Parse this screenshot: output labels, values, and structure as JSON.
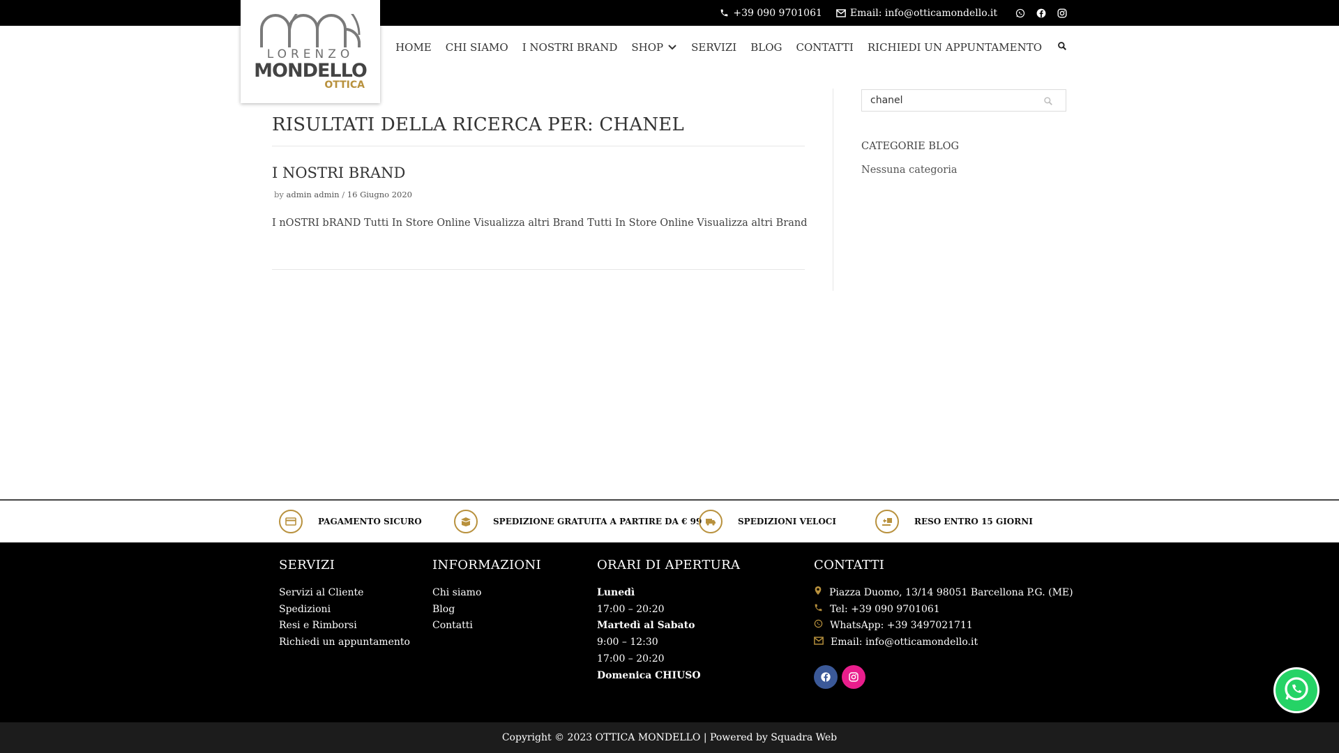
{
  "topbar": {
    "phone": "+39 090 9701061",
    "email": "Email: info@otticamondello.it",
    "socials": [
      "whatsapp-icon",
      "facebook-icon",
      "instagram-icon"
    ]
  },
  "logo": {
    "line1": "LORENZO",
    "line2": "MONDELLO",
    "line3": "OTTICA"
  },
  "nav": {
    "items": [
      "HOME",
      "CHI SIAMO",
      "I NOSTRI BRAND",
      "SHOP",
      "SERVIZI",
      "BLOG",
      "CONTATTI",
      "RICHIEDI UN APPUNTAMENTO"
    ]
  },
  "main": {
    "results_title": "RISULTATI DELLA RICERCA PER: CHANEL",
    "post": {
      "title": "I NOSTRI BRAND",
      "by": "by",
      "author": "admin admin",
      "sep": "/",
      "date": "16 Giugno 2020",
      "excerpt": "I nOSTRI bRAND Tutti In Store Online Visualizza altri Brand Tutti In Store Online Visualizza altri Brand"
    }
  },
  "sidebar": {
    "search_value": "chanel",
    "categories_title": "CATEGORIE BLOG",
    "categories_empty": "Nessuna categoria"
  },
  "features": [
    "PAGAMENTO SICURO",
    "SPEDIZIONE GRATUITA A PARTIRE DA € 99",
    "SPEDIZIONI VELOCI",
    "RESO ENTRO 15 GIORNI"
  ],
  "footer": {
    "servizi": {
      "title": "SERVIZI",
      "items": [
        "Servizi al Cliente",
        "Spedizioni",
        "Resi e Rimborsi",
        "Richiedi un appuntamento"
      ]
    },
    "info": {
      "title": "INFORMAZIONI",
      "items": [
        "Chi siamo",
        "Blog",
        "Contatti"
      ]
    },
    "orari": {
      "title": "ORARI DI APERTURA",
      "lines": [
        {
          "text": "Lunedì",
          "bold": true
        },
        {
          "text": "17:00 – 20:20",
          "bold": false
        },
        {
          "text": "Martedì al Sabato",
          "bold": true
        },
        {
          "text": "9:00 – 12:30",
          "bold": false
        },
        {
          "text": "17:00 – 20:20",
          "bold": false
        },
        {
          "text": "Domenica CHIUSO",
          "bold": true
        }
      ]
    },
    "contatti": {
      "title": "CONTATTI",
      "address": "Piazza Duomo, 13/14 98051 Barcellona P.G. (ME)",
      "tel": "Tel: +39 090 9701061",
      "whatsapp": "WhatsApp: +39 3497021711",
      "email": "Email: info@otticamondello.it"
    }
  },
  "copyright": "Copyright © 2023 OTTICA MONDELLO | Powered by Squadra Web",
  "colors": {
    "gold": "#b8913d",
    "facebook": "#3b5998",
    "instagram": "#e91e8c",
    "whatsapp": "#25d366"
  }
}
